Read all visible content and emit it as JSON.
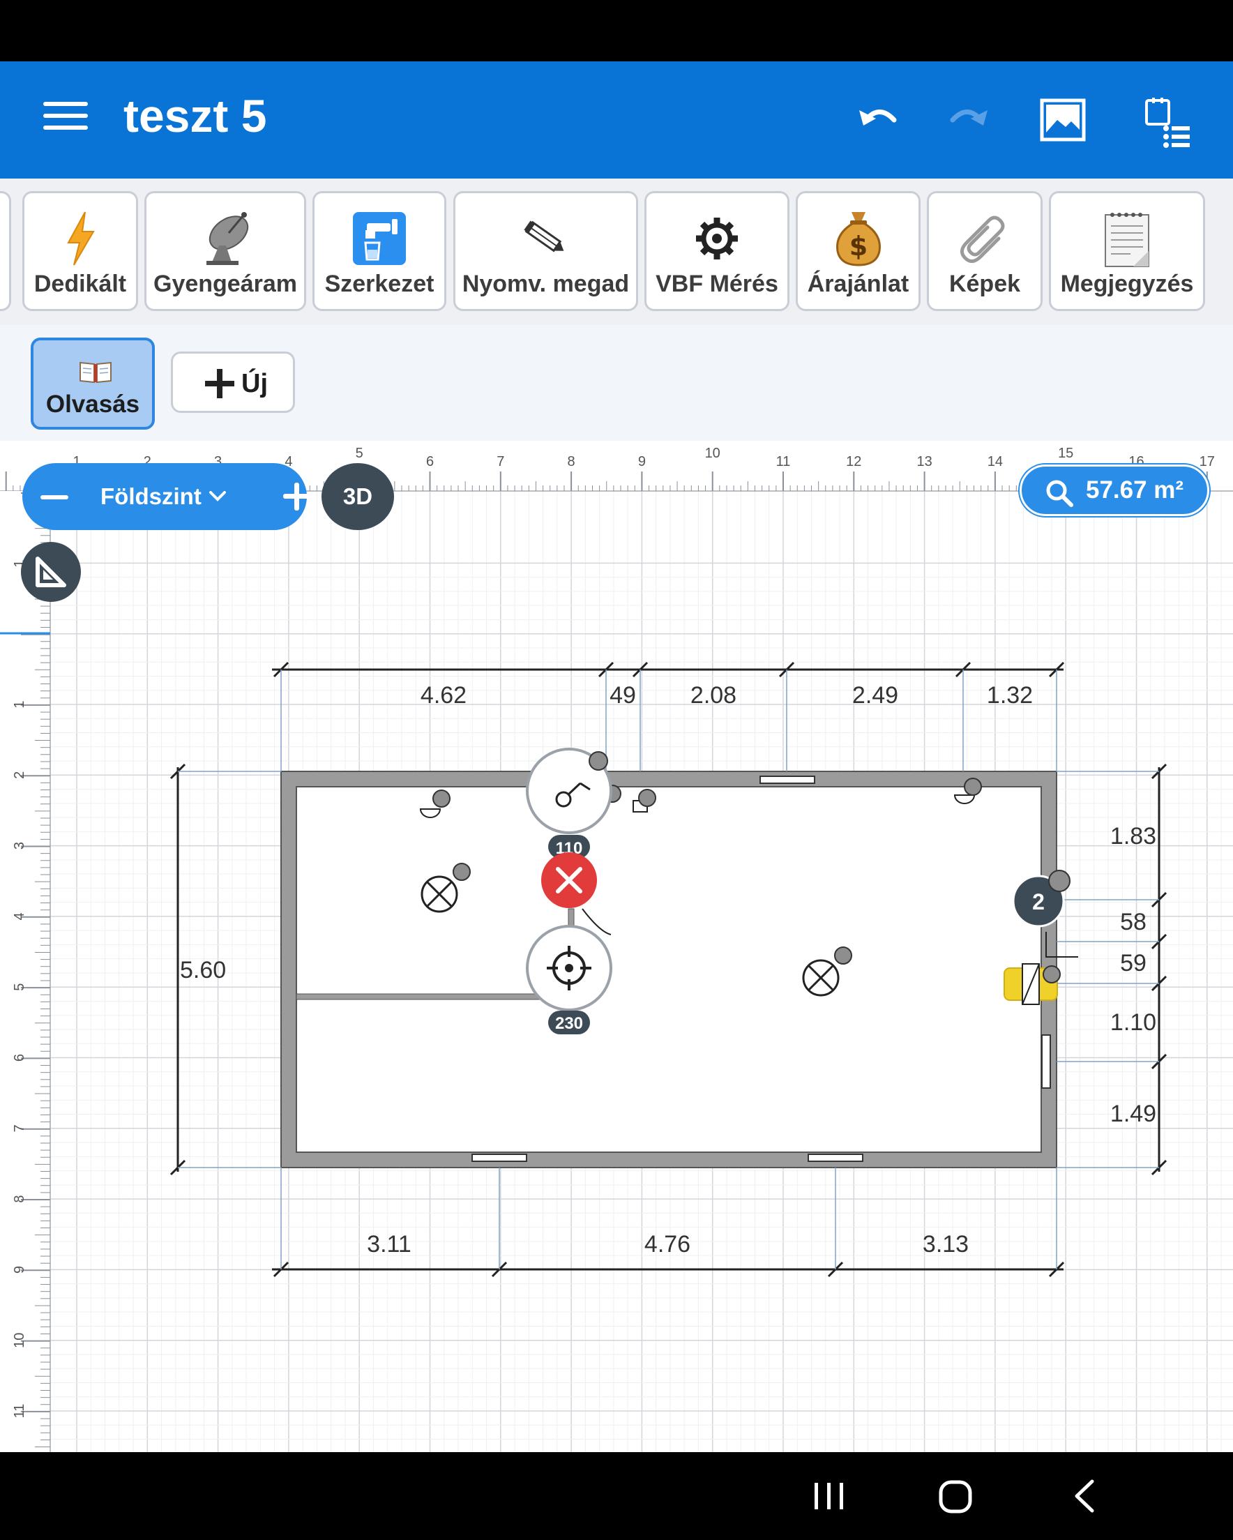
{
  "app_bar": {
    "title": "teszt 5",
    "icons": [
      "menu-icon",
      "undo-icon",
      "redo-icon",
      "image-icon",
      "task-list-icon"
    ],
    "accent": "#0a73d6"
  },
  "toolbar": {
    "items": [
      {
        "label": "Dedikált",
        "icon": "lightning-icon"
      },
      {
        "label": "Gyengeáram",
        "icon": "satellite-dish-icon"
      },
      {
        "label": "Szerkezet",
        "icon": "faucet-icon"
      },
      {
        "label": "Nyomv. megad",
        "icon": "pencil-icon"
      },
      {
        "label": "VBF Mérés",
        "icon": "gear-icon"
      },
      {
        "label": "Árajánlat",
        "icon": "money-bag-icon"
      },
      {
        "label": "Képek",
        "icon": "paperclip-icon"
      },
      {
        "label": "Megjegyzés",
        "icon": "notepad-icon"
      }
    ]
  },
  "subbar": {
    "read_label": "Olvasás",
    "new_label": "Új"
  },
  "canvas": {
    "floor_name": "Földszint",
    "view_3d_label": "3D",
    "area_value": "57.67 m²",
    "ruler_top": [
      "1",
      "2",
      "3",
      "4",
      "5",
      "6",
      "7",
      "8",
      "9",
      "10",
      "11",
      "12",
      "13",
      "14",
      "15",
      "16",
      "17"
    ],
    "ruler_left": [
      "1",
      "1",
      "2",
      "3",
      "4",
      "5",
      "6",
      "7",
      "8",
      "9",
      "10",
      "11"
    ],
    "dimensions_top": [
      "4.62",
      "49",
      "2.08",
      "2.49",
      "1.32"
    ],
    "dimensions_bottom": [
      "3.11",
      "4.76",
      "3.13"
    ],
    "dimension_left": "5.60",
    "dimensions_right": [
      "1.83",
      "58",
      "59",
      "1.10",
      "1.49"
    ],
    "switch_height": "110",
    "socket_height": "230",
    "device_count": "2"
  },
  "nav_bar": {
    "icons": [
      "recents-icon",
      "home-icon",
      "back-icon"
    ]
  }
}
